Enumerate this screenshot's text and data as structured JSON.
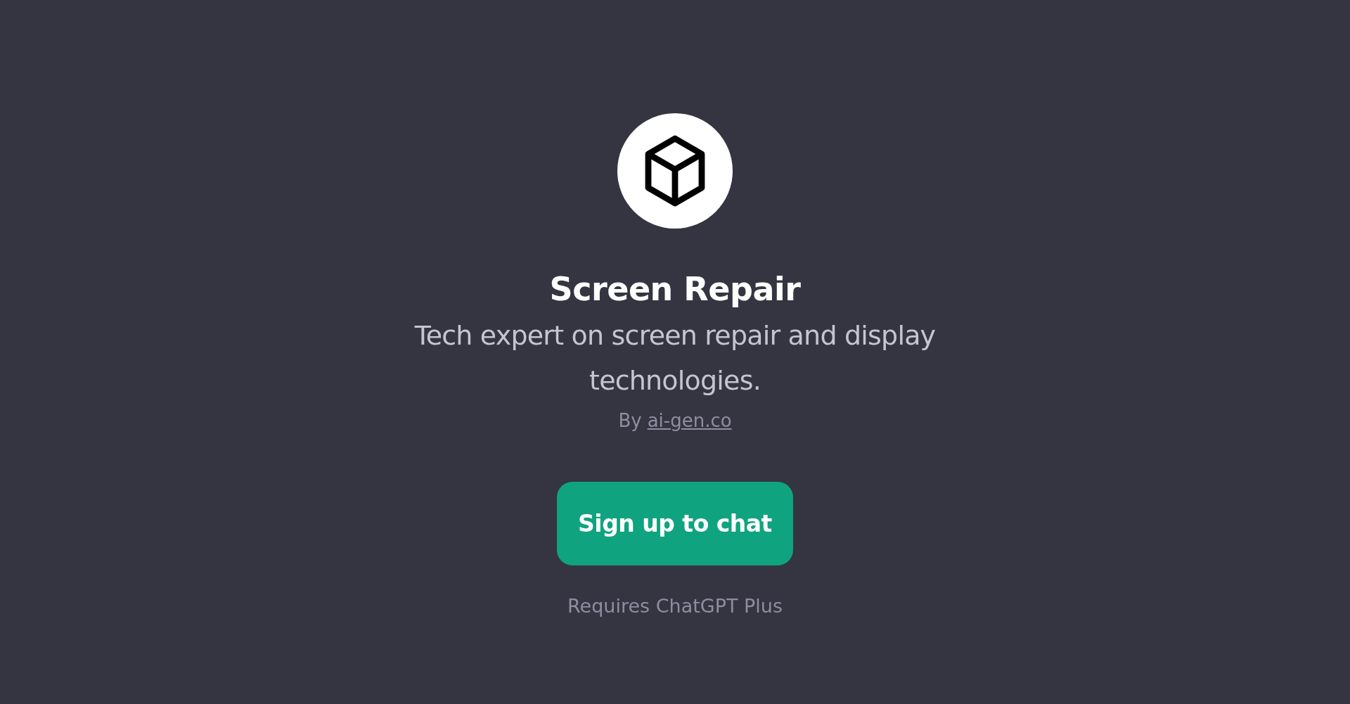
{
  "title": "Screen Repair",
  "description": "Tech expert on screen repair and display technologies.",
  "byline": {
    "prefix": "By",
    "link": "ai-gen.co"
  },
  "button": "Sign up to chat",
  "note": "Requires ChatGPT Plus"
}
